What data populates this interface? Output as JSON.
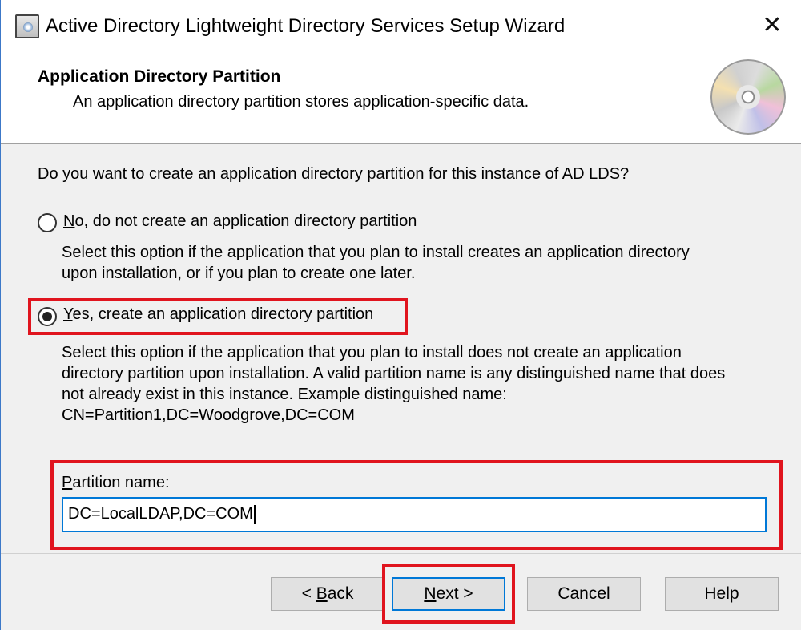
{
  "window": {
    "title": "Active Directory Lightweight Directory Services Setup Wizard",
    "close_glyph": "✕"
  },
  "header": {
    "title": "Application Directory Partition",
    "subtitle": "An application directory partition stores application-specific data."
  },
  "body": {
    "question": "Do you want to create an application directory partition for this instance of AD LDS?",
    "option_no": {
      "mnemonic": "N",
      "label_rest": "o, do not create an application directory partition",
      "selected": false,
      "description": [
        "Select this option if the application that you plan to install creates an application directory",
        "upon installation, or if you plan to create one later."
      ]
    },
    "option_yes": {
      "mnemonic": "Y",
      "label_rest": "es, create an application directory partition",
      "selected": true,
      "description": [
        "Select this option if the application that you plan to install does not create an application",
        "directory partition upon installation. A valid partition name is any distinguished name that does",
        "not already exist in this instance. Example distinguished name:",
        "CN=Partition1,DC=Woodgrove,DC=COM"
      ]
    },
    "partition": {
      "label_mnemonic": "P",
      "label_rest": "artition name:",
      "value": "DC=LocalLDAP,DC=COM"
    }
  },
  "buttons": {
    "back": {
      "prefix": "< ",
      "mnemonic": "B",
      "rest": "ack"
    },
    "next": {
      "mnemonic": "N",
      "rest": "ext >"
    },
    "cancel": "Cancel",
    "help": "Help"
  },
  "colors": {
    "highlight_red": "#e0141e",
    "focus_blue": "#0078d7",
    "dialog_bg": "#f0f0f0"
  },
  "icons": {
    "app": "setup-wizard-icon",
    "header": "cd-disc-icon",
    "close": "close-icon"
  }
}
